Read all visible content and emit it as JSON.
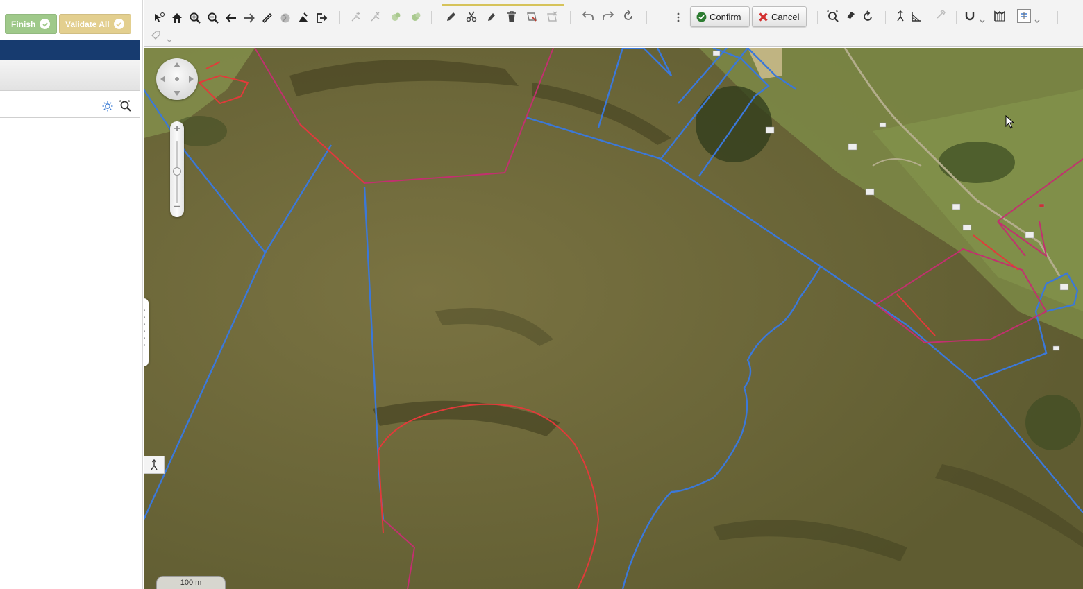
{
  "sidebar": {
    "finish_label": "Finish",
    "validate_label": "Validate All"
  },
  "toolbar": {
    "confirm_label": "Confirm",
    "cancel_label": "Cancel",
    "icons": [
      "info-identify",
      "home",
      "zoom-in",
      "zoom-out",
      "back",
      "forward",
      "measure-ruler",
      "globe",
      "layer-brush",
      "exit",
      "add-vertex",
      "remove-vertex",
      "merge-parcel",
      "split-parcel",
      "draw-pencil",
      "cut-scissors",
      "edit-pen",
      "delete-trash",
      "parcel-edit",
      "parcel-remove",
      "undo",
      "redo",
      "refresh",
      "more-vertical",
      "zoom-select",
      "eraser",
      "reset",
      "north-arrow",
      "angle-measure",
      "link",
      "magnet-snap",
      "map-grid",
      "layer-switch",
      "tag"
    ]
  },
  "map": {
    "scale_label": "100 m",
    "colors": {
      "blue_boundary": "#3b78d9",
      "red_boundary": "#e23a3a",
      "magenta_boundary": "#c2306f",
      "terrain": "#6f6a3a"
    }
  }
}
